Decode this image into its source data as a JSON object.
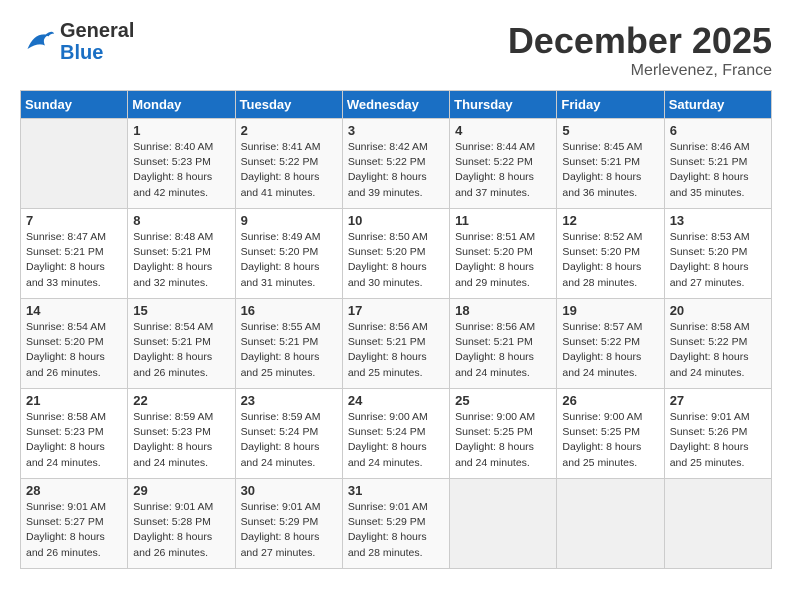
{
  "header": {
    "logo_line1": "General",
    "logo_line2": "Blue",
    "month": "December 2025",
    "location": "Merlevenez, France"
  },
  "days_of_week": [
    "Sunday",
    "Monday",
    "Tuesday",
    "Wednesday",
    "Thursday",
    "Friday",
    "Saturday"
  ],
  "weeks": [
    [
      {
        "day": "",
        "sunrise": "",
        "sunset": "",
        "daylight": ""
      },
      {
        "day": "1",
        "sunrise": "Sunrise: 8:40 AM",
        "sunset": "Sunset: 5:23 PM",
        "daylight": "Daylight: 8 hours and 42 minutes."
      },
      {
        "day": "2",
        "sunrise": "Sunrise: 8:41 AM",
        "sunset": "Sunset: 5:22 PM",
        "daylight": "Daylight: 8 hours and 41 minutes."
      },
      {
        "day": "3",
        "sunrise": "Sunrise: 8:42 AM",
        "sunset": "Sunset: 5:22 PM",
        "daylight": "Daylight: 8 hours and 39 minutes."
      },
      {
        "day": "4",
        "sunrise": "Sunrise: 8:44 AM",
        "sunset": "Sunset: 5:22 PM",
        "daylight": "Daylight: 8 hours and 37 minutes."
      },
      {
        "day": "5",
        "sunrise": "Sunrise: 8:45 AM",
        "sunset": "Sunset: 5:21 PM",
        "daylight": "Daylight: 8 hours and 36 minutes."
      },
      {
        "day": "6",
        "sunrise": "Sunrise: 8:46 AM",
        "sunset": "Sunset: 5:21 PM",
        "daylight": "Daylight: 8 hours and 35 minutes."
      }
    ],
    [
      {
        "day": "7",
        "sunrise": "Sunrise: 8:47 AM",
        "sunset": "Sunset: 5:21 PM",
        "daylight": "Daylight: 8 hours and 33 minutes."
      },
      {
        "day": "8",
        "sunrise": "Sunrise: 8:48 AM",
        "sunset": "Sunset: 5:21 PM",
        "daylight": "Daylight: 8 hours and 32 minutes."
      },
      {
        "day": "9",
        "sunrise": "Sunrise: 8:49 AM",
        "sunset": "Sunset: 5:20 PM",
        "daylight": "Daylight: 8 hours and 31 minutes."
      },
      {
        "day": "10",
        "sunrise": "Sunrise: 8:50 AM",
        "sunset": "Sunset: 5:20 PM",
        "daylight": "Daylight: 8 hours and 30 minutes."
      },
      {
        "day": "11",
        "sunrise": "Sunrise: 8:51 AM",
        "sunset": "Sunset: 5:20 PM",
        "daylight": "Daylight: 8 hours and 29 minutes."
      },
      {
        "day": "12",
        "sunrise": "Sunrise: 8:52 AM",
        "sunset": "Sunset: 5:20 PM",
        "daylight": "Daylight: 8 hours and 28 minutes."
      },
      {
        "day": "13",
        "sunrise": "Sunrise: 8:53 AM",
        "sunset": "Sunset: 5:20 PM",
        "daylight": "Daylight: 8 hours and 27 minutes."
      }
    ],
    [
      {
        "day": "14",
        "sunrise": "Sunrise: 8:54 AM",
        "sunset": "Sunset: 5:20 PM",
        "daylight": "Daylight: 8 hours and 26 minutes."
      },
      {
        "day": "15",
        "sunrise": "Sunrise: 8:54 AM",
        "sunset": "Sunset: 5:21 PM",
        "daylight": "Daylight: 8 hours and 26 minutes."
      },
      {
        "day": "16",
        "sunrise": "Sunrise: 8:55 AM",
        "sunset": "Sunset: 5:21 PM",
        "daylight": "Daylight: 8 hours and 25 minutes."
      },
      {
        "day": "17",
        "sunrise": "Sunrise: 8:56 AM",
        "sunset": "Sunset: 5:21 PM",
        "daylight": "Daylight: 8 hours and 25 minutes."
      },
      {
        "day": "18",
        "sunrise": "Sunrise: 8:56 AM",
        "sunset": "Sunset: 5:21 PM",
        "daylight": "Daylight: 8 hours and 24 minutes."
      },
      {
        "day": "19",
        "sunrise": "Sunrise: 8:57 AM",
        "sunset": "Sunset: 5:22 PM",
        "daylight": "Daylight: 8 hours and 24 minutes."
      },
      {
        "day": "20",
        "sunrise": "Sunrise: 8:58 AM",
        "sunset": "Sunset: 5:22 PM",
        "daylight": "Daylight: 8 hours and 24 minutes."
      }
    ],
    [
      {
        "day": "21",
        "sunrise": "Sunrise: 8:58 AM",
        "sunset": "Sunset: 5:23 PM",
        "daylight": "Daylight: 8 hours and 24 minutes."
      },
      {
        "day": "22",
        "sunrise": "Sunrise: 8:59 AM",
        "sunset": "Sunset: 5:23 PM",
        "daylight": "Daylight: 8 hours and 24 minutes."
      },
      {
        "day": "23",
        "sunrise": "Sunrise: 8:59 AM",
        "sunset": "Sunset: 5:24 PM",
        "daylight": "Daylight: 8 hours and 24 minutes."
      },
      {
        "day": "24",
        "sunrise": "Sunrise: 9:00 AM",
        "sunset": "Sunset: 5:24 PM",
        "daylight": "Daylight: 8 hours and 24 minutes."
      },
      {
        "day": "25",
        "sunrise": "Sunrise: 9:00 AM",
        "sunset": "Sunset: 5:25 PM",
        "daylight": "Daylight: 8 hours and 24 minutes."
      },
      {
        "day": "26",
        "sunrise": "Sunrise: 9:00 AM",
        "sunset": "Sunset: 5:25 PM",
        "daylight": "Daylight: 8 hours and 25 minutes."
      },
      {
        "day": "27",
        "sunrise": "Sunrise: 9:01 AM",
        "sunset": "Sunset: 5:26 PM",
        "daylight": "Daylight: 8 hours and 25 minutes."
      }
    ],
    [
      {
        "day": "28",
        "sunrise": "Sunrise: 9:01 AM",
        "sunset": "Sunset: 5:27 PM",
        "daylight": "Daylight: 8 hours and 26 minutes."
      },
      {
        "day": "29",
        "sunrise": "Sunrise: 9:01 AM",
        "sunset": "Sunset: 5:28 PM",
        "daylight": "Daylight: 8 hours and 26 minutes."
      },
      {
        "day": "30",
        "sunrise": "Sunrise: 9:01 AM",
        "sunset": "Sunset: 5:29 PM",
        "daylight": "Daylight: 8 hours and 27 minutes."
      },
      {
        "day": "31",
        "sunrise": "Sunrise: 9:01 AM",
        "sunset": "Sunset: 5:29 PM",
        "daylight": "Daylight: 8 hours and 28 minutes."
      },
      {
        "day": "",
        "sunrise": "",
        "sunset": "",
        "daylight": ""
      },
      {
        "day": "",
        "sunrise": "",
        "sunset": "",
        "daylight": ""
      },
      {
        "day": "",
        "sunrise": "",
        "sunset": "",
        "daylight": ""
      }
    ]
  ]
}
